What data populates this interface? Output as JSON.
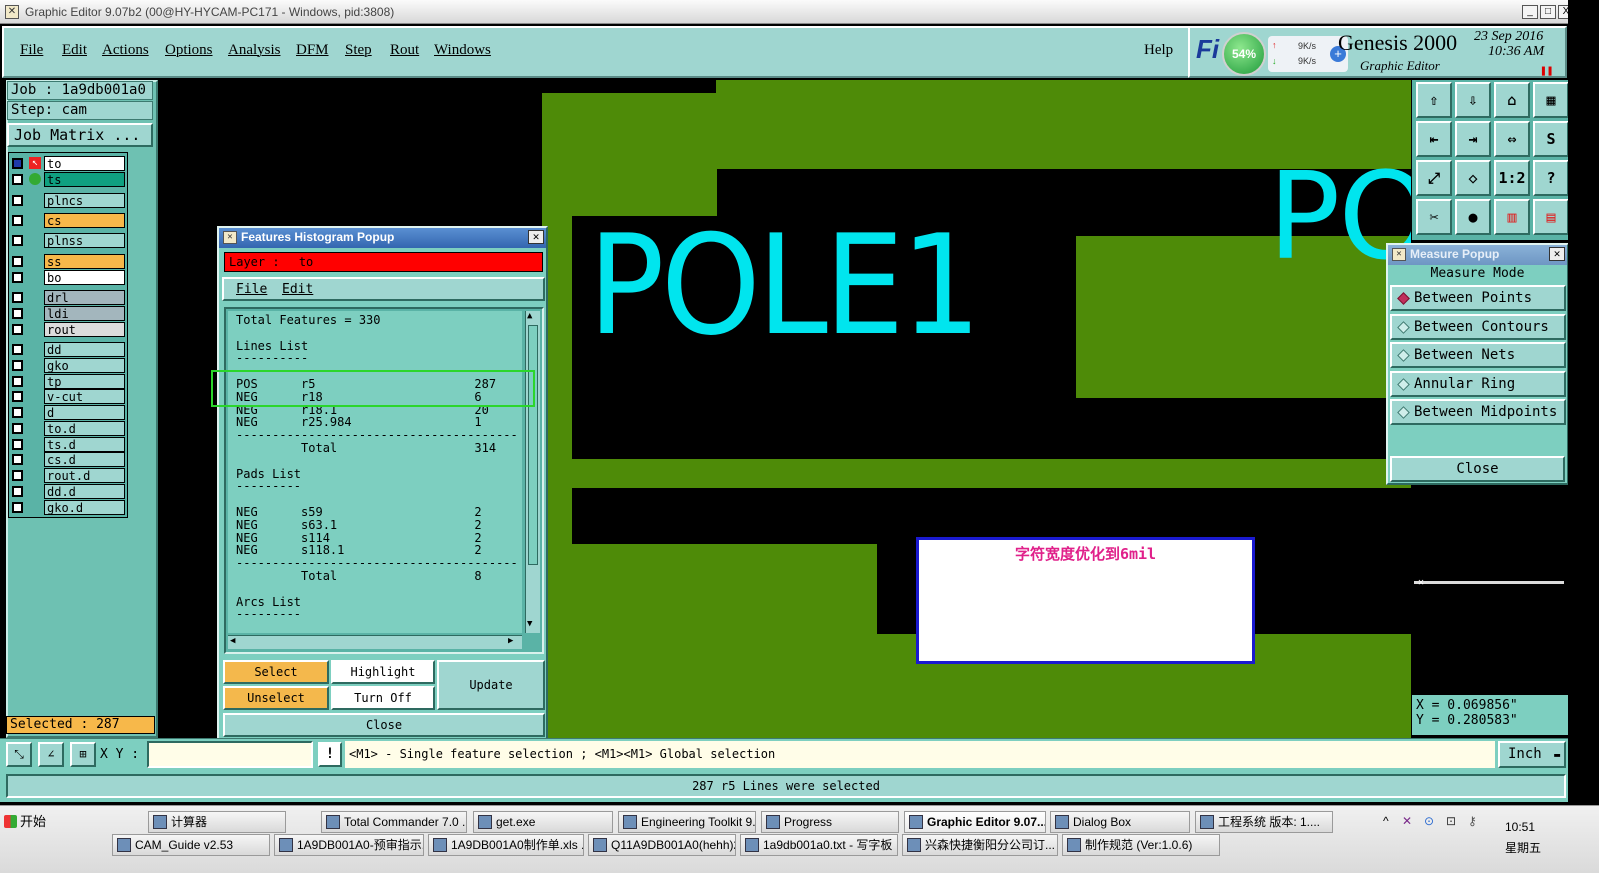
{
  "window": {
    "title": "Graphic Editor 9.07b2 (00@HY-HYCAM-PC171 - Windows, pid:3808)",
    "minimize": "_",
    "close": "X"
  },
  "menus": [
    "File",
    "Edit",
    "Actions",
    "Options",
    "Analysis",
    "DFM",
    "Step",
    "Rout",
    "Windows"
  ],
  "help": "Help",
  "brand": {
    "title": "Genesis 2000",
    "subtitle": "Graphic Editor",
    "date": "23 Sep 2016",
    "time": "10:36 AM",
    "logo": "Fi",
    "cpu": "54%",
    "net_up": "9K/s",
    "net_down": "9K/s"
  },
  "job": {
    "job_label": "Job :",
    "job_value": "1a9db001a0",
    "step_label": "Step:",
    "step_value": "cam",
    "matrix_button": "Job Matrix ..."
  },
  "layers": [
    {
      "name": "to",
      "color": "#ffffff"
    },
    {
      "name": "ts",
      "color": "#0fa080"
    },
    {
      "name": "plncs",
      "color": "#9fd6d0"
    },
    {
      "name": "cs",
      "color": "#f7b84a"
    },
    {
      "name": "plnss",
      "color": "#9fd6d0"
    },
    {
      "name": "ss",
      "color": "#f7b84a"
    },
    {
      "name": "bo",
      "color": "#ffffff"
    },
    {
      "name": "drl",
      "color": "#a3b6bd"
    },
    {
      "name": "ldi",
      "color": "#a3b6bd"
    },
    {
      "name": "rout",
      "color": "#dcdcdc"
    },
    {
      "name": "dd",
      "color": "#9fd6d0"
    },
    {
      "name": "gko",
      "color": "#9fd6d0"
    },
    {
      "name": "tp",
      "color": "#9fd6d0"
    },
    {
      "name": "v-cut",
      "color": "#9fd6d0"
    },
    {
      "name": "d",
      "color": "#9fd6d0"
    },
    {
      "name": "to.d",
      "color": "#9fd6d0"
    },
    {
      "name": "ts.d",
      "color": "#9fd6d0"
    },
    {
      "name": "cs.d",
      "color": "#9fd6d0"
    },
    {
      "name": "rout.d",
      "color": "#9fd6d0"
    },
    {
      "name": "dd.d",
      "color": "#9fd6d0"
    },
    {
      "name": "gko.d",
      "color": "#9fd6d0"
    }
  ],
  "selected": "Selected : 287",
  "histogram": {
    "title": "Features Histogram Popup",
    "layer_label": "Layer :",
    "layer_value": "to",
    "menus": [
      "File",
      "Edit"
    ],
    "lines": [
      "Total Features = 330",
      "",
      "Lines List",
      "----------",
      "",
      "POS      r5                      287",
      "NEG      r18                     6",
      "NEG      r18.1                   20",
      "NEG      r25.984                 1",
      "---------------------------------------",
      "         Total                   314",
      "",
      "Pads List",
      "---------",
      "",
      "NEG      s59                     2",
      "NEG      s63.1                   2",
      "NEG      s114                    2",
      "NEG      s118.1                  2",
      "---------------------------------------",
      "         Total                   8",
      "",
      "Arcs List",
      "---------"
    ],
    "buttons": {
      "select": "Select",
      "highlight": "Highlight",
      "update": "Update",
      "unselect": "Unselect",
      "turn_off": "Turn Off",
      "close": "Close"
    }
  },
  "canvas": {
    "text1": "POLE1",
    "text2": "PO",
    "note": "字符宽度优化到6mil",
    "board_color": "#4e8b08",
    "text_color": "#00e5ee"
  },
  "measure": {
    "title": "Measure Popup",
    "mode_label": "Measure Mode",
    "modes": [
      "Between Points",
      "Between Contours",
      "Between Nets",
      "Annular Ring",
      "Between Midpoints"
    ],
    "close": "Close",
    "x": "X = 0.069856\"",
    "y": "Y = 0.280583\""
  },
  "toolbar": [
    "⇧",
    "⇩",
    "⌂",
    "▦",
    "⇤",
    "⇥",
    "⇔",
    "S",
    "⤢",
    "◇",
    "1:2",
    "?",
    "✂",
    "●",
    "▥",
    "▤"
  ],
  "bottom": {
    "xy_label": "X Y :",
    "xy_value": "",
    "alert_icon": "!",
    "message": "<M1> - Single feature selection ; <M1><M1> Global selection",
    "units": "Inch",
    "status": "287 r5 Lines were selected"
  },
  "taskbar": {
    "start": "开始",
    "row1": [
      "计算器",
      "Total Commander 7.0 ...",
      "get.exe",
      "Engineering Toolkit 9....",
      "Progress",
      "Graphic Editor 9.07...",
      "Dialog Box",
      "工程系统  版本: 1...."
    ],
    "row2": [
      "CAM_Guide v2.53",
      "1A9DB001A0-预审指示...",
      "1A9DB001A0制作单.xls ...",
      "Q11A9DB001A0(hehh)2...",
      "1a9db001a0.txt - 写字板",
      "兴森快捷衡阳分公司订...",
      "制作规范 (Ver:1.0.6)"
    ],
    "clock_time": "10:51",
    "clock_day": "星期五"
  }
}
